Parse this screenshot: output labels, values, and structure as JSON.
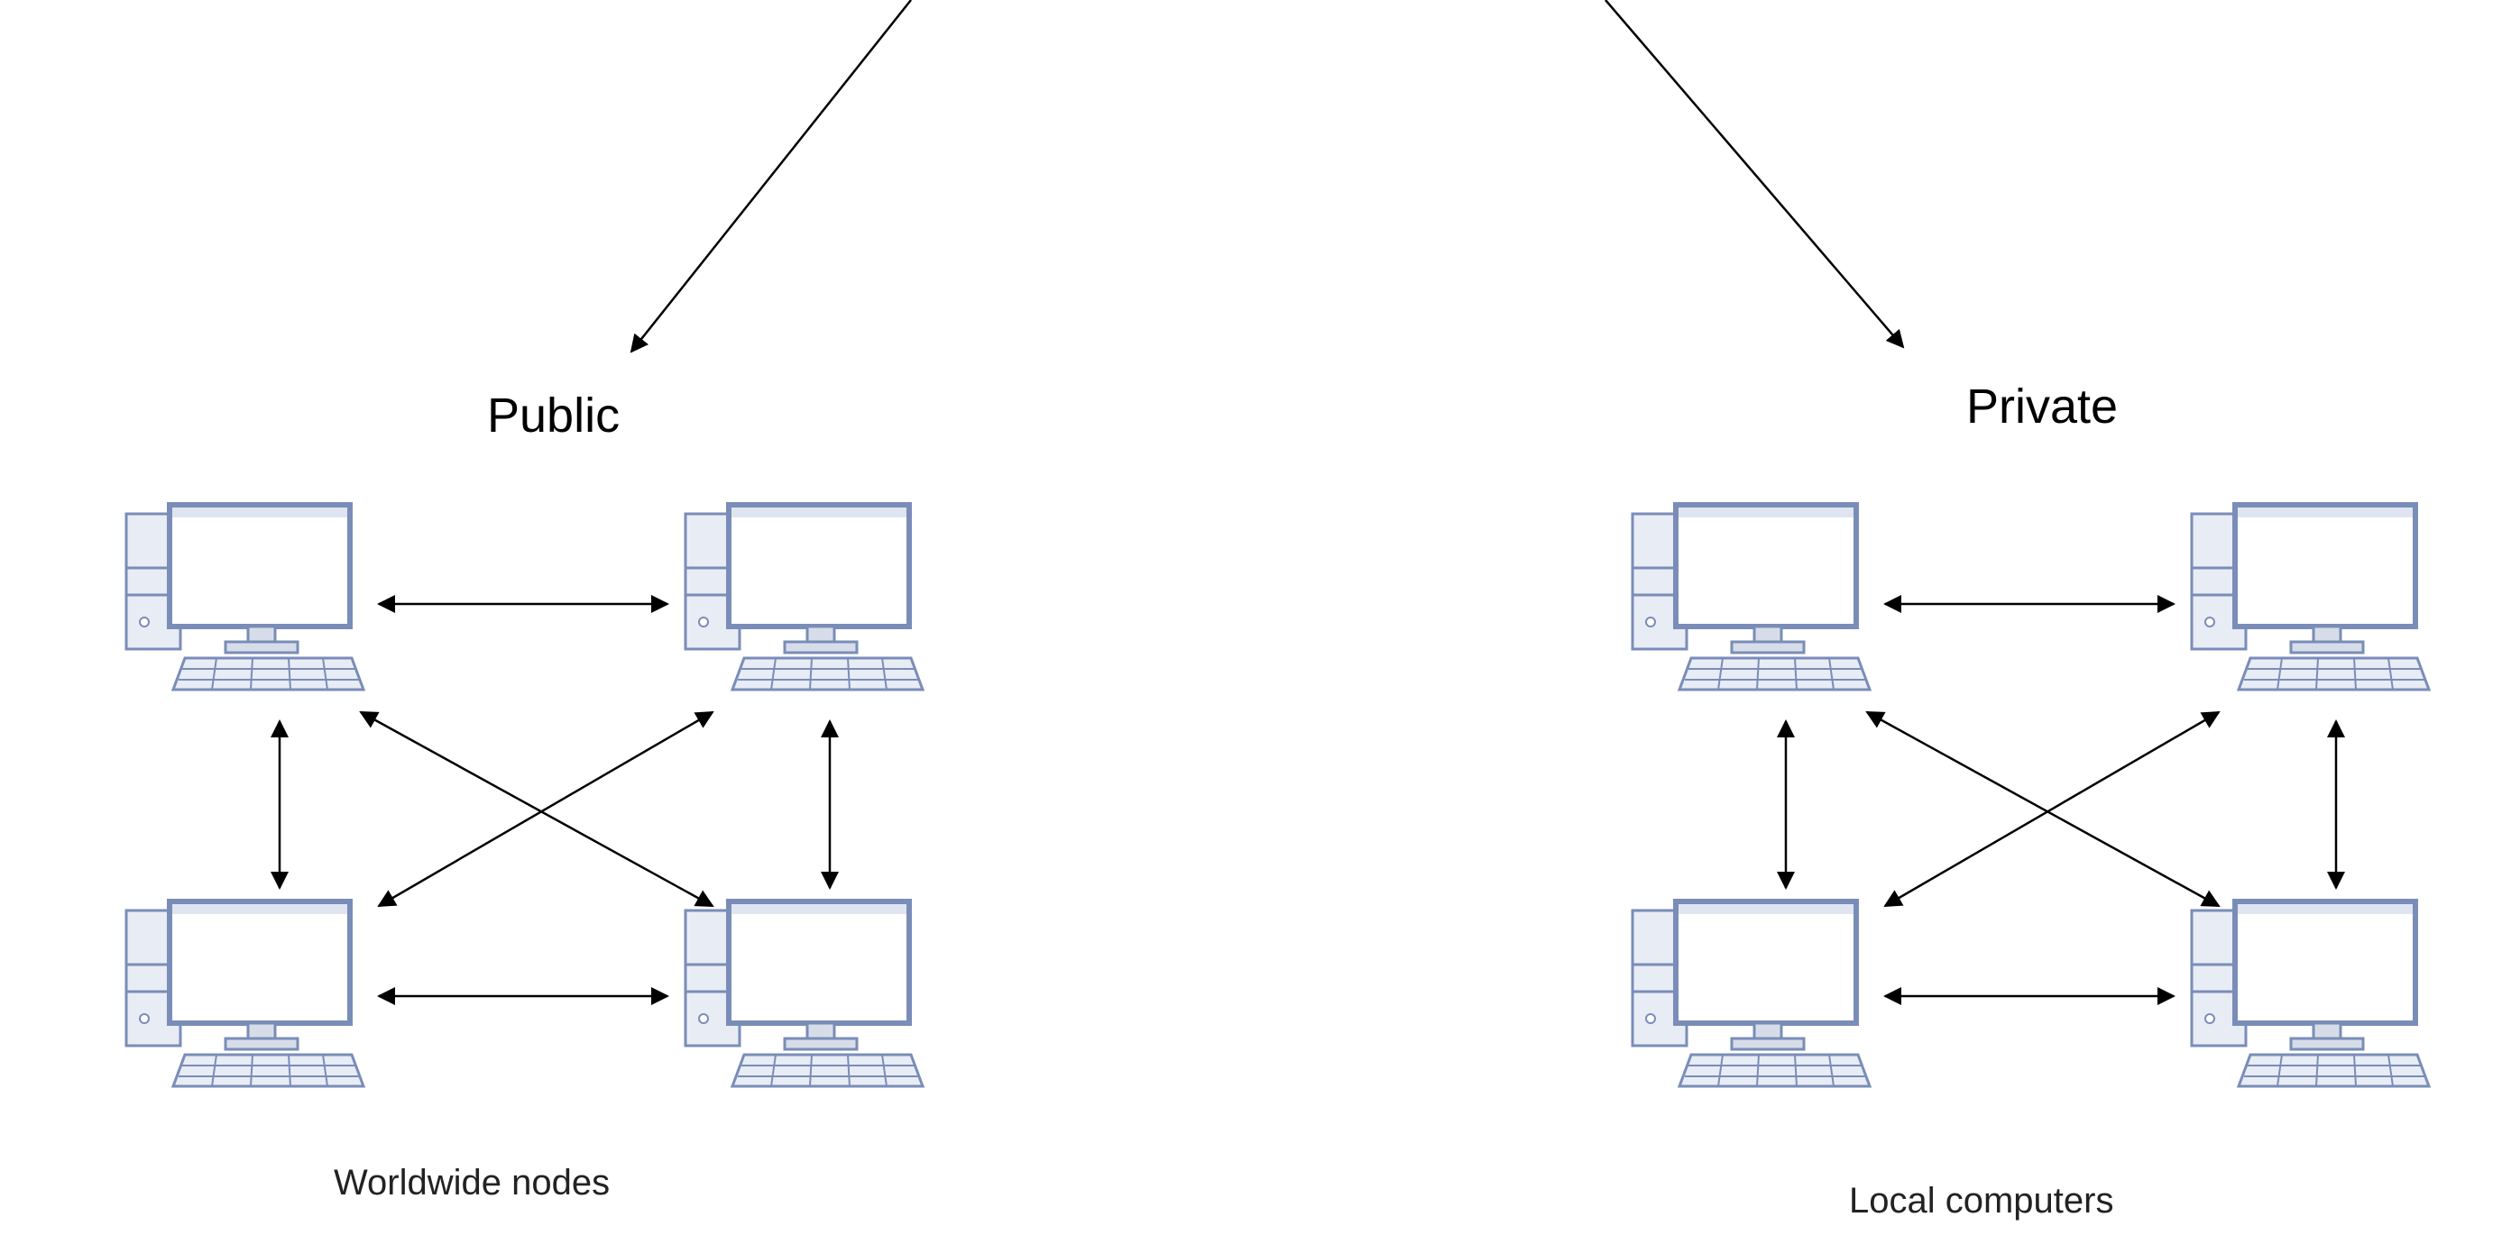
{
  "left": {
    "title": "Public",
    "caption": "Worldwide nodes"
  },
  "right": {
    "title": "Private",
    "caption": "Local computers"
  },
  "icon_label": "computer-node"
}
